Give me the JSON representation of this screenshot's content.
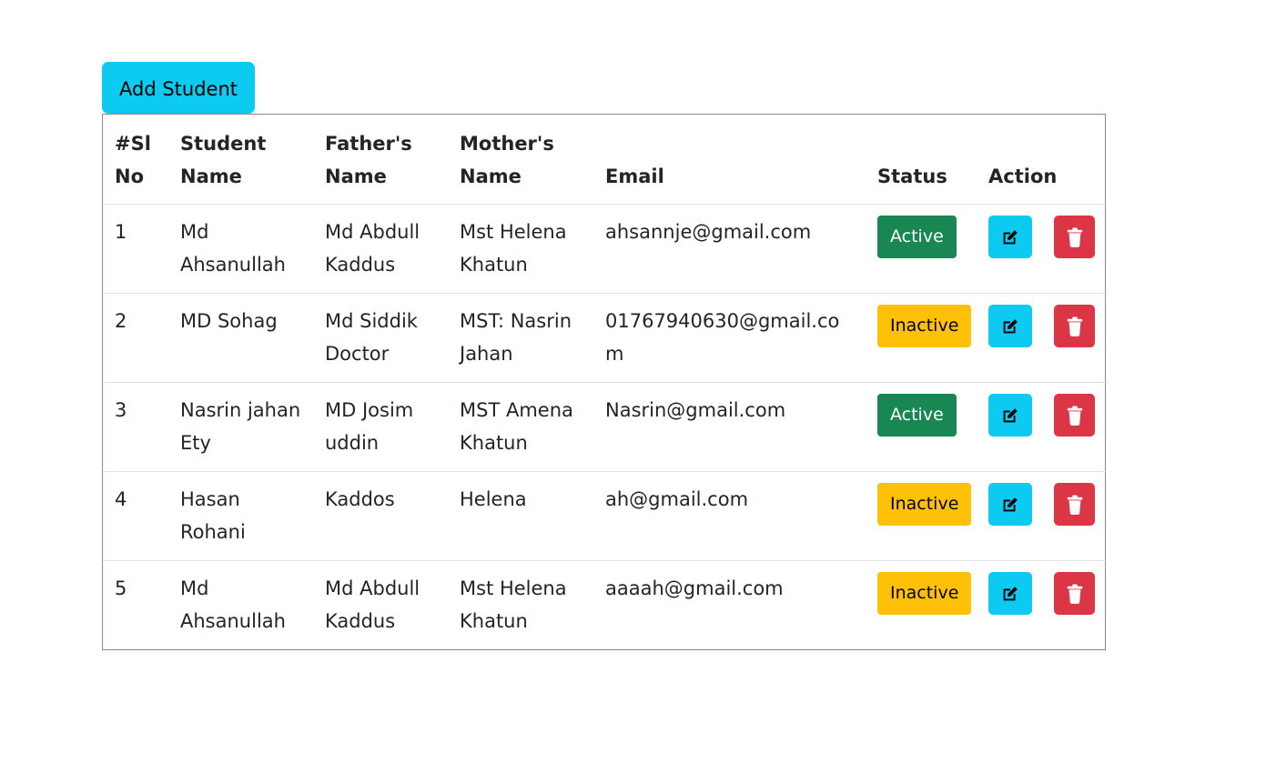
{
  "toolbar": {
    "add_label": "Add Student"
  },
  "table": {
    "headers": {
      "sl": "#Sl No",
      "student": "Student Name",
      "father": "Father's Name",
      "mother": "Mother's Name",
      "email": "Email",
      "status": "Status",
      "action": "Action"
    },
    "rows": [
      {
        "sl": "1",
        "student": "Md Ahsanullah",
        "father": "Md Abdull Kaddus",
        "mother": "Mst Helena Khatun",
        "email": "ahsannje@gmail.com",
        "status": "Active",
        "status_kind": "active"
      },
      {
        "sl": "2",
        "student": "MD Sohag",
        "father": "Md Siddik Doctor",
        "mother": "MST: Nasrin Jahan",
        "email": "01767940630@gmail.com",
        "status": "Inactive",
        "status_kind": "inactive"
      },
      {
        "sl": "3",
        "student": "Nasrin jahan Ety",
        "father": "MD Josim uddin",
        "mother": "MST Amena Khatun",
        "email": "Nasrin@gmail.com",
        "status": "Active",
        "status_kind": "active"
      },
      {
        "sl": "4",
        "student": "Hasan Rohani",
        "father": "Kaddos",
        "mother": "Helena",
        "email": "ah@gmail.com",
        "status": "Inactive",
        "status_kind": "inactive"
      },
      {
        "sl": "5",
        "student": "Md Ahsanullah",
        "father": "Md Abdull Kaddus",
        "mother": "Mst Helena Khatun",
        "email": "aaaah@gmail.com",
        "status": "Inactive",
        "status_kind": "inactive"
      }
    ]
  },
  "icons": {
    "edit": "edit-icon",
    "delete": "trash-icon"
  },
  "colors": {
    "add_button": "#0dcaf0",
    "active_badge": "#198754",
    "inactive_badge": "#ffc107",
    "edit_button": "#0dcaf0",
    "delete_button": "#dc3545"
  }
}
